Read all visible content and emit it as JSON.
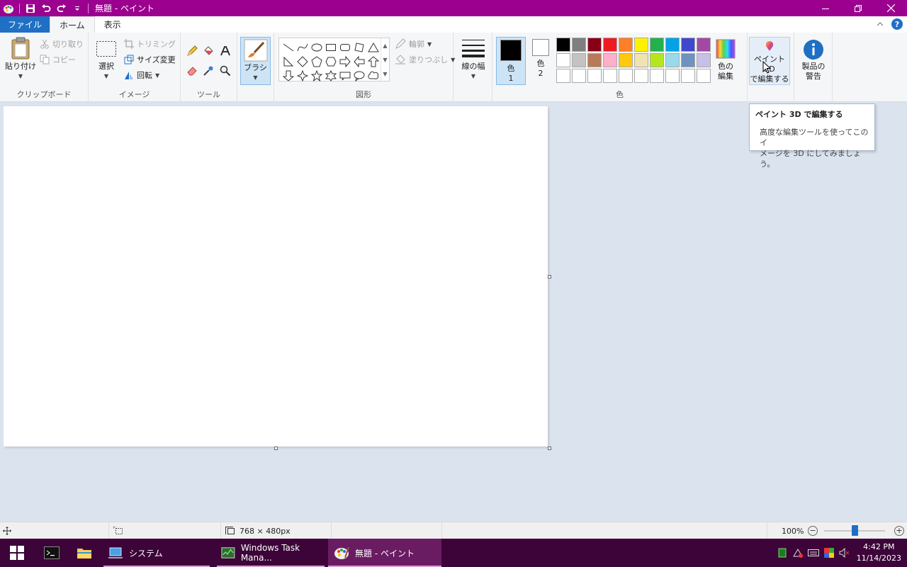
{
  "window": {
    "title": "無題 - ペイント"
  },
  "tabs": [
    {
      "label": "ファイル"
    },
    {
      "label": "ホーム"
    },
    {
      "label": "表示"
    }
  ],
  "clipboard": {
    "paste": "貼り付け",
    "cut": "切り取り",
    "copy": "コピー",
    "group": "クリップボード"
  },
  "image": {
    "select": "選択",
    "crop": "トリミング",
    "resize": "サイズ変更",
    "rotate": "回転",
    "group": "イメージ"
  },
  "tools": {
    "group": "ツール"
  },
  "brush": {
    "label": "ブラシ"
  },
  "shapes": {
    "outline": "輪郭",
    "fill": "塗りつぶし",
    "group": "図形"
  },
  "size": {
    "label": "線の幅"
  },
  "colors": {
    "color1_line1": "色",
    "color1_line2": "1",
    "color2_line1": "色",
    "color2_line2": "2",
    "edit_line1": "色の",
    "edit_line2": "編集",
    "group": "色",
    "color1_value": "#000000",
    "color2_value": "#ffffff",
    "palette": [
      "#000000",
      "#7f7f7f",
      "#880015",
      "#ed1c24",
      "#ff7f27",
      "#fff200",
      "#22b14c",
      "#00a2e8",
      "#3f48cc",
      "#a349a4",
      "#ffffff",
      "#c3c3c3",
      "#b97a57",
      "#ffaec9",
      "#ffc90e",
      "#efe4b0",
      "#b5e61d",
      "#99d9ea",
      "#7092be",
      "#c8bfe7",
      "#ffffff",
      "#ffffff",
      "#ffffff",
      "#ffffff",
      "#ffffff",
      "#ffffff",
      "#ffffff",
      "#ffffff",
      "#ffffff",
      "#ffffff"
    ]
  },
  "paint3d": {
    "line1": "ペイント 3D",
    "line2": "で編集する"
  },
  "product_alert": {
    "line1": "製品の",
    "line2": "警告"
  },
  "tooltip": {
    "title": "ペイント 3D で編集する",
    "body_line1": "高度な編集ツールを使ってこのイ",
    "body_line2": "メージを 3D にしてみましょう。"
  },
  "status": {
    "image_size": "768 × 480px",
    "zoom": "100%"
  },
  "taskbar": {
    "items": [
      {
        "label": "システム"
      },
      {
        "label": "Windows Task Mana..."
      },
      {
        "label": "無題 - ペイント"
      }
    ],
    "time": "4:42 PM",
    "date": "11/14/2023"
  }
}
